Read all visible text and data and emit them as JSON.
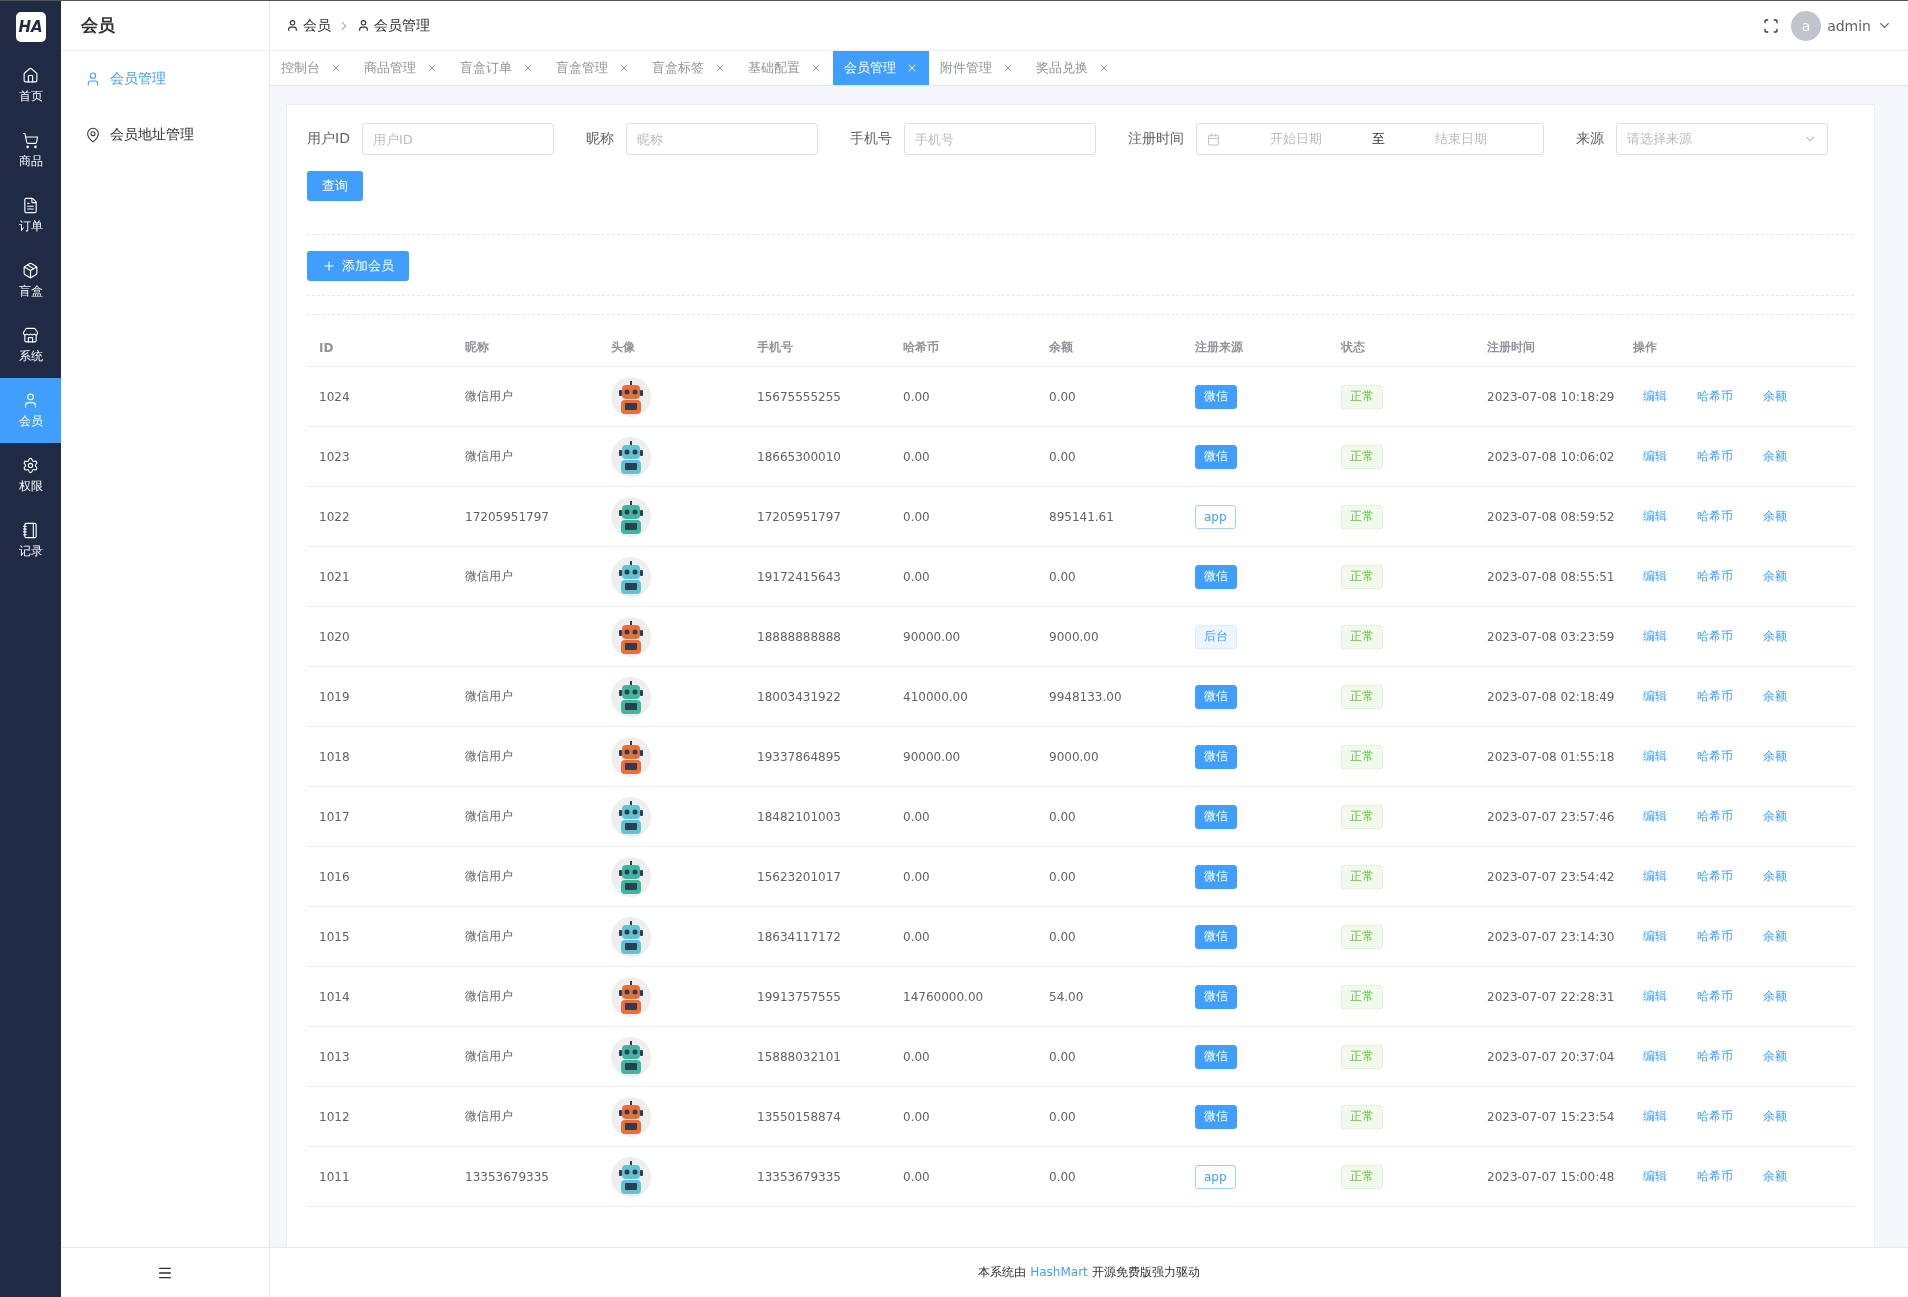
{
  "rail": {
    "logo": "HA",
    "items": [
      {
        "label": "首页",
        "selected": false
      },
      {
        "label": "商品",
        "selected": false
      },
      {
        "label": "订单",
        "selected": false
      },
      {
        "label": "盲盒",
        "selected": false
      },
      {
        "label": "系统",
        "selected": false
      },
      {
        "label": "会员",
        "selected": true
      },
      {
        "label": "权限",
        "selected": false
      },
      {
        "label": "记录",
        "selected": false
      }
    ]
  },
  "submenu": {
    "title": "会员",
    "items": [
      {
        "label": "会员管理",
        "selected": true
      },
      {
        "label": "会员地址管理",
        "selected": false
      }
    ]
  },
  "breadcrumb": [
    "会员",
    "会员管理"
  ],
  "user": {
    "avatar_letter": "a",
    "name": "admin"
  },
  "tabs": [
    {
      "label": "控制台",
      "selected": false
    },
    {
      "label": "商品管理",
      "selected": false
    },
    {
      "label": "盲盒订单",
      "selected": false
    },
    {
      "label": "盲盒管理",
      "selected": false
    },
    {
      "label": "盲盒标签",
      "selected": false
    },
    {
      "label": "基础配置",
      "selected": false
    },
    {
      "label": "会员管理",
      "selected": true
    },
    {
      "label": "附件管理",
      "selected": false
    },
    {
      "label": "奖品兑换",
      "selected": false
    }
  ],
  "filters": {
    "fields": [
      {
        "label": "用户ID",
        "placeholder": "用户ID"
      },
      {
        "label": "昵称",
        "placeholder": "昵称"
      },
      {
        "label": "手机号",
        "placeholder": "手机号"
      }
    ],
    "date": {
      "label": "注册时间",
      "start_placeholder": "开始日期",
      "separator": "至",
      "end_placeholder": "结束日期"
    },
    "source": {
      "label": "来源",
      "placeholder": "请选择来源"
    },
    "query_button": "查询"
  },
  "add_button": "添加会员",
  "table": {
    "columns": [
      "ID",
      "昵称",
      "头像",
      "手机号",
      "哈希币",
      "余额",
      "注册来源",
      "状态",
      "注册时间",
      "操作"
    ],
    "rows": [
      {
        "id": "1024",
        "nickname": "微信用户",
        "phone": "15675555255",
        "coins": "0.00",
        "balance": "0.00",
        "source": {
          "label": "微信",
          "kind": "wechat"
        },
        "status": {
          "label": "正常",
          "kind": "success"
        },
        "registered": "2023-07-08 10:18:29",
        "actions": [
          "编辑",
          "哈希币",
          "余额"
        ]
      },
      {
        "id": "1023",
        "nickname": "微信用户",
        "phone": "18665300010",
        "coins": "0.00",
        "balance": "0.00",
        "source": {
          "label": "微信",
          "kind": "wechat"
        },
        "status": {
          "label": "正常",
          "kind": "success"
        },
        "registered": "2023-07-08 10:06:02",
        "actions": [
          "编辑",
          "哈希币",
          "余额"
        ]
      },
      {
        "id": "1022",
        "nickname": "17205951797",
        "phone": "17205951797",
        "coins": "0.00",
        "balance": "895141.61",
        "source": {
          "label": "app",
          "kind": "app"
        },
        "status": {
          "label": "正常",
          "kind": "success"
        },
        "registered": "2023-07-08 08:59:52",
        "actions": [
          "编辑",
          "哈希币",
          "余额"
        ]
      },
      {
        "id": "1021",
        "nickname": "微信用户",
        "phone": "19172415643",
        "coins": "0.00",
        "balance": "0.00",
        "source": {
          "label": "微信",
          "kind": "wechat"
        },
        "status": {
          "label": "正常",
          "kind": "success"
        },
        "registered": "2023-07-08 08:55:51",
        "actions": [
          "编辑",
          "哈希币",
          "余额"
        ]
      },
      {
        "id": "1020",
        "phone": "18888888888",
        "coins": "90000.00",
        "balance": "9000.00",
        "source": {
          "label": "后台",
          "kind": "admin"
        },
        "status": {
          "label": "正常",
          "kind": "success"
        },
        "registered": "2023-07-08 03:23:59",
        "actions": [
          "编辑",
          "哈希币",
          "余额"
        ]
      },
      {
        "id": "1019",
        "nickname": "微信用户",
        "phone": "18003431922",
        "coins": "410000.00",
        "balance": "9948133.00",
        "source": {
          "label": "微信",
          "kind": "wechat"
        },
        "status": {
          "label": "正常",
          "kind": "success"
        },
        "registered": "2023-07-08 02:18:49",
        "actions": [
          "编辑",
          "哈希币",
          "余额"
        ]
      },
      {
        "id": "1018",
        "nickname": "微信用户",
        "phone": "19337864895",
        "coins": "90000.00",
        "balance": "9000.00",
        "source": {
          "label": "微信",
          "kind": "wechat"
        },
        "status": {
          "label": "正常",
          "kind": "success"
        },
        "registered": "2023-07-08 01:55:18",
        "actions": [
          "编辑",
          "哈希币",
          "余额"
        ]
      },
      {
        "id": "1017",
        "nickname": "微信用户",
        "phone": "18482101003",
        "coins": "0.00",
        "balance": "0.00",
        "source": {
          "label": "微信",
          "kind": "wechat"
        },
        "status": {
          "label": "正常",
          "kind": "success"
        },
        "registered": "2023-07-07 23:57:46",
        "actions": [
          "编辑",
          "哈希币",
          "余额"
        ]
      },
      {
        "id": "1016",
        "nickname": "微信用户",
        "phone": "15623201017",
        "coins": "0.00",
        "balance": "0.00",
        "source": {
          "label": "微信",
          "kind": "wechat"
        },
        "status": {
          "label": "正常",
          "kind": "success"
        },
        "registered": "2023-07-07 23:54:42",
        "actions": [
          "编辑",
          "哈希币",
          "余额"
        ]
      },
      {
        "id": "1015",
        "nickname": "微信用户",
        "phone": "18634117172",
        "coins": "0.00",
        "balance": "0.00",
        "source": {
          "label": "微信",
          "kind": "wechat"
        },
        "status": {
          "label": "正常",
          "kind": "success"
        },
        "registered": "2023-07-07 23:14:30",
        "actions": [
          "编辑",
          "哈希币",
          "余额"
        ]
      },
      {
        "id": "1014",
        "nickname": "微信用户",
        "phone": "19913757555",
        "coins": "14760000.00",
        "balance": "54.00",
        "source": {
          "label": "微信",
          "kind": "wechat"
        },
        "status": {
          "label": "正常",
          "kind": "success"
        },
        "registered": "2023-07-07 22:28:31",
        "actions": [
          "编辑",
          "哈希币",
          "余额"
        ]
      },
      {
        "id": "1013",
        "nickname": "微信用户",
        "phone": "15888032101",
        "coins": "0.00",
        "balance": "0.00",
        "source": {
          "label": "微信",
          "kind": "wechat"
        },
        "status": {
          "label": "正常",
          "kind": "success"
        },
        "registered": "2023-07-07 20:37:04",
        "actions": [
          "编辑",
          "哈希币",
          "余额"
        ]
      },
      {
        "id": "1012",
        "nickname": "微信用户",
        "phone": "13550158874",
        "coins": "0.00",
        "balance": "0.00",
        "source": {
          "label": "微信",
          "kind": "wechat"
        },
        "status": {
          "label": "正常",
          "kind": "success"
        },
        "registered": "2023-07-07 15:23:54",
        "actions": [
          "编辑",
          "哈希币",
          "余额"
        ]
      },
      {
        "id": "1011",
        "nickname": "13353679335",
        "phone": "13353679335",
        "coins": "0.00",
        "balance": "0.00",
        "source": {
          "label": "app",
          "kind": "app"
        },
        "status": {
          "label": "正常",
          "kind": "success"
        },
        "registered": "2023-07-07 15:00:48",
        "actions": [
          "编辑",
          "哈希币",
          "余额"
        ]
      }
    ]
  },
  "footer": {
    "before": "本系统由",
    "link": "HashMart",
    "after": "开源免费版强力驱动"
  }
}
